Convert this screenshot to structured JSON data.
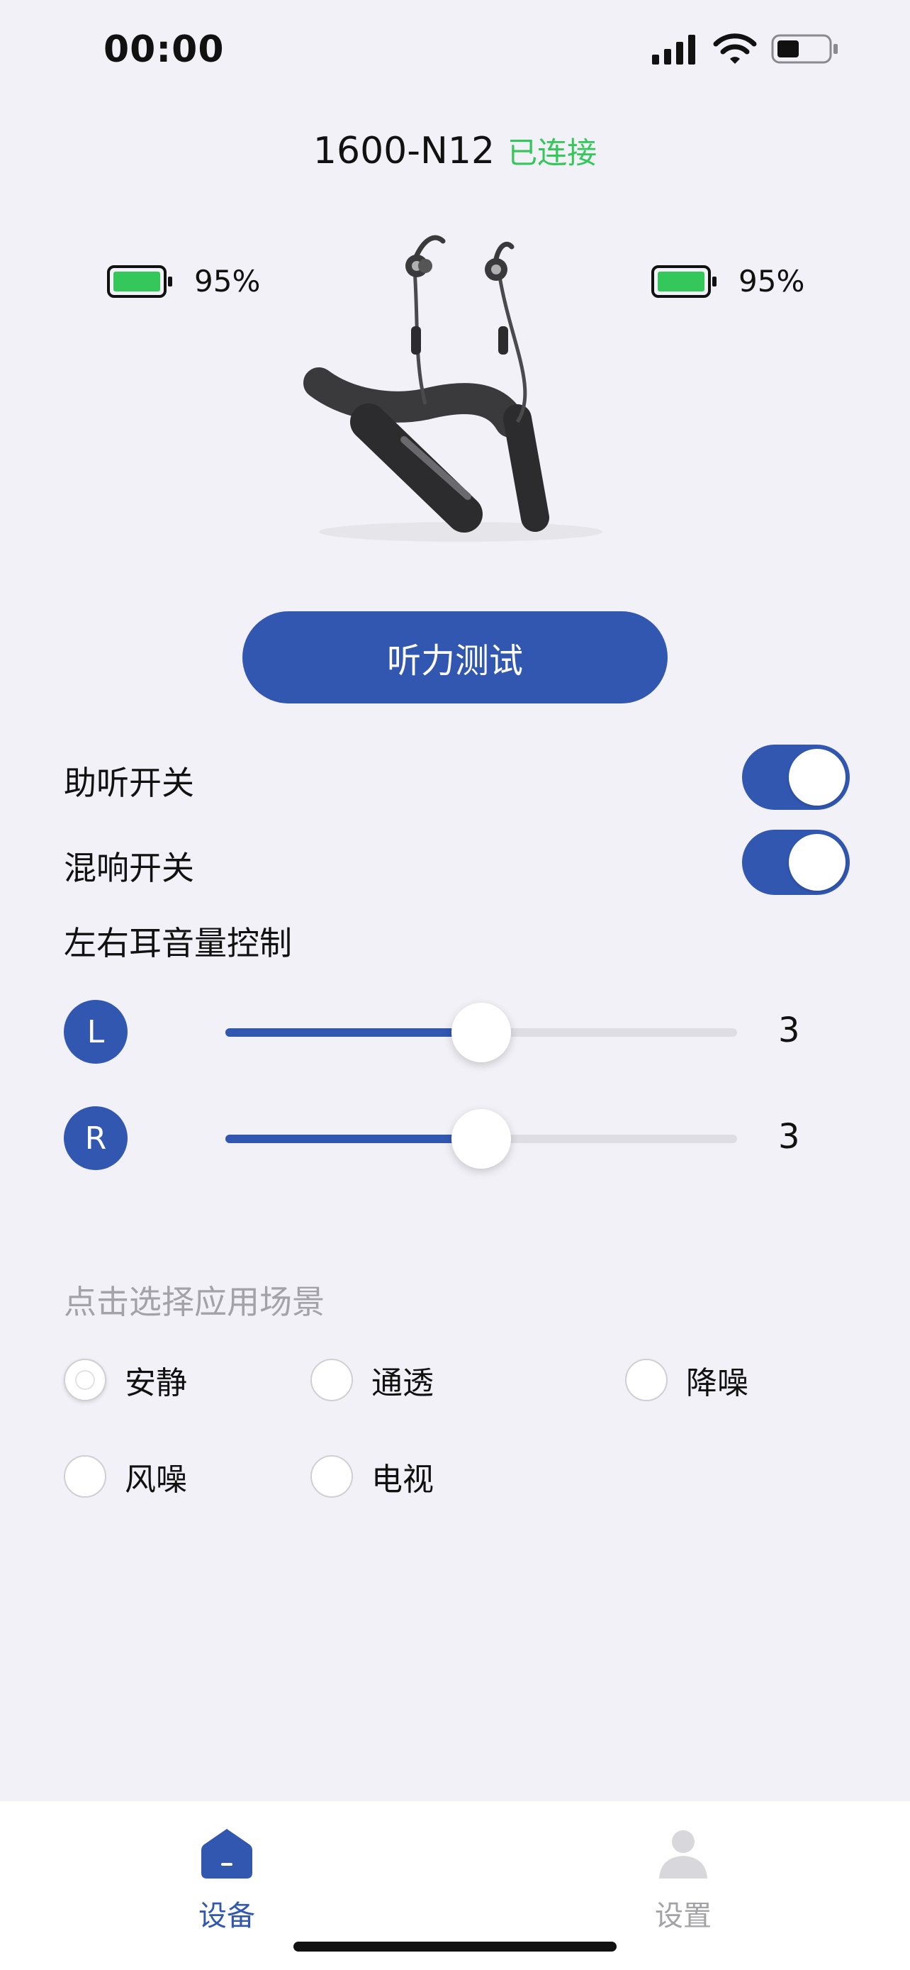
{
  "status_bar": {
    "time": "00:00"
  },
  "device": {
    "name": "1600-N12",
    "status": "已连接"
  },
  "battery": {
    "left_percent": "95%",
    "right_percent": "95%"
  },
  "hearing_test_button": "听力测试",
  "toggles": {
    "hearing_aid": {
      "label": "助听开关",
      "on": true
    },
    "reverb": {
      "label": "混响开关",
      "on": true
    }
  },
  "volume": {
    "title": "左右耳音量控制",
    "left": {
      "badge": "L",
      "value": "3",
      "level": 0.5
    },
    "right": {
      "badge": "R",
      "value": "3",
      "level": 0.5
    }
  },
  "scene": {
    "title": "点击选择应用场景",
    "options": [
      "安静",
      "通透",
      "降噪",
      "风噪",
      "电视"
    ],
    "selected": "安静"
  },
  "tabs": [
    {
      "label": "设备",
      "icon": "home-icon",
      "active": true
    },
    {
      "label": "设置",
      "icon": "person-icon",
      "active": false
    }
  ],
  "colors": {
    "accent": "#3157b1",
    "connected": "#34c759",
    "battery": "#34c759",
    "muted": "#a3a2a8"
  }
}
